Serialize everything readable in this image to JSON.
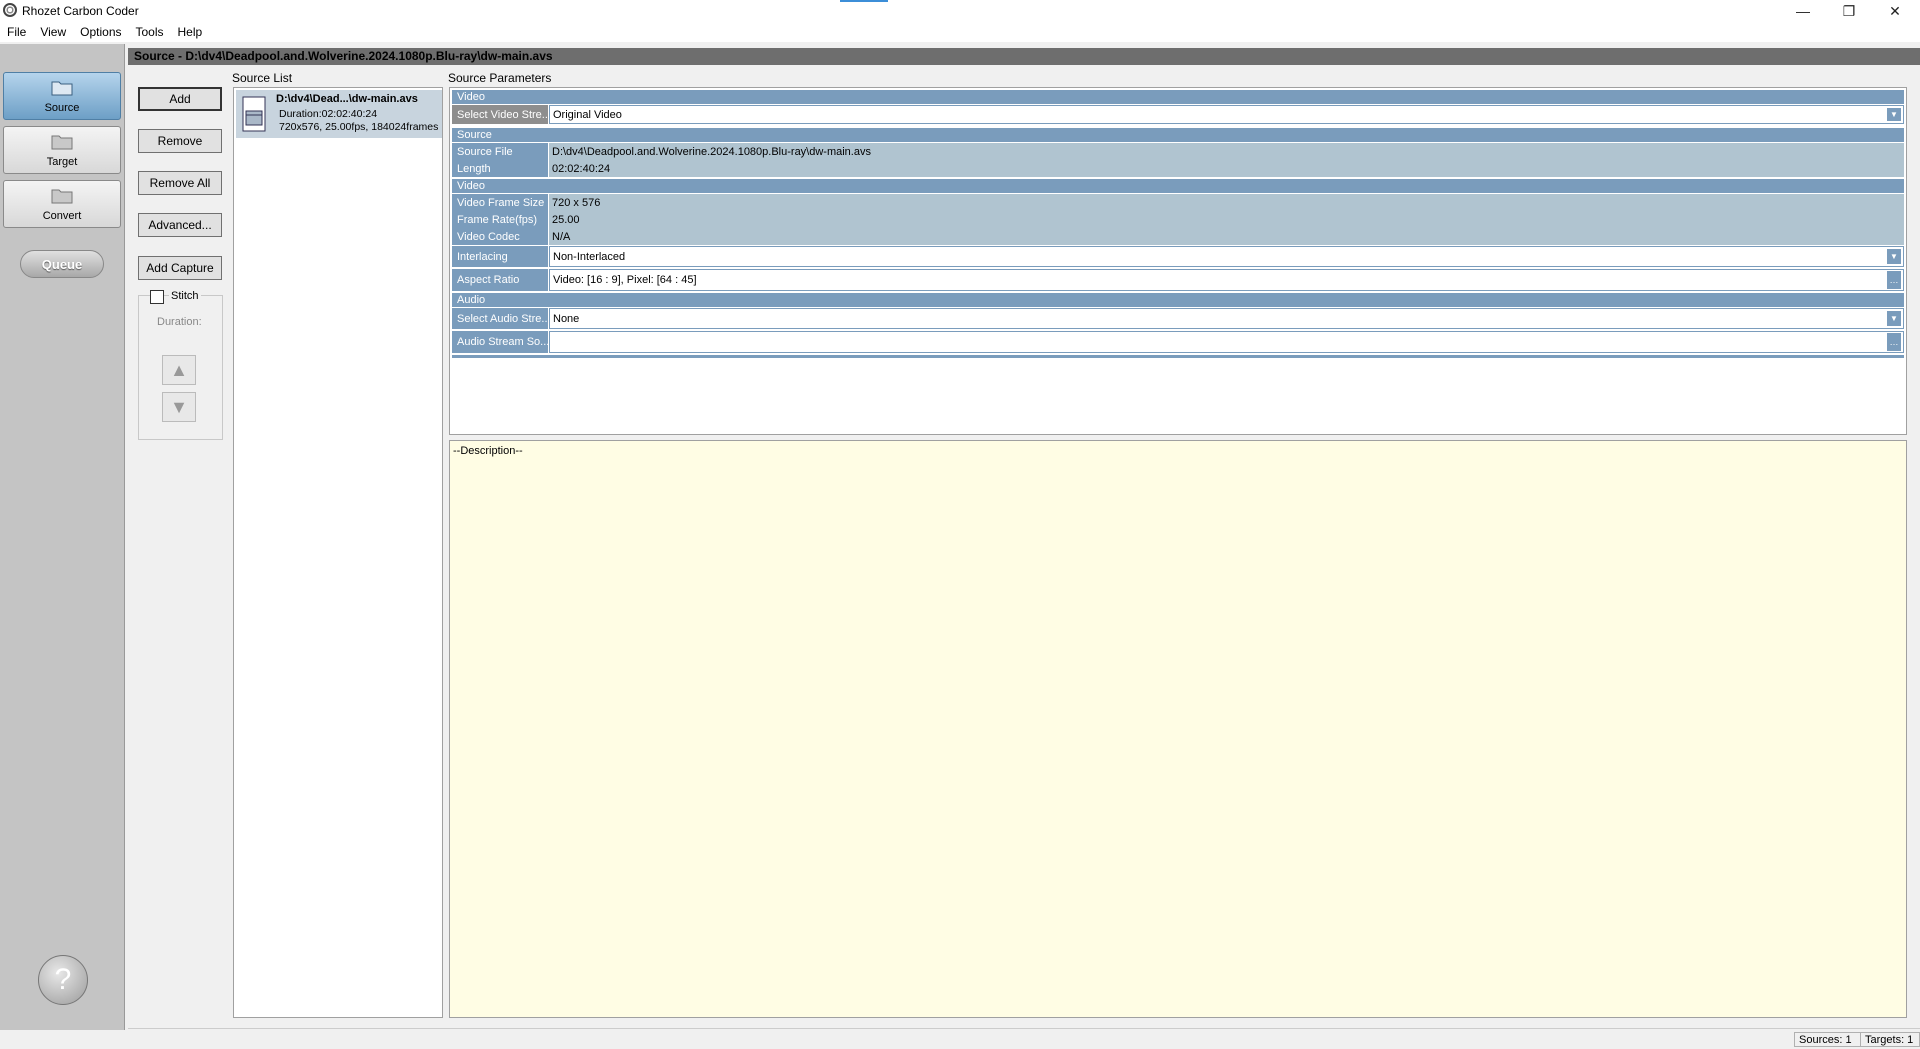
{
  "window": {
    "title": "Rhozet Carbon Coder",
    "controls": {
      "minimize": "—",
      "restore": "❐",
      "close": "✕"
    }
  },
  "menu": [
    "File",
    "View",
    "Options",
    "Tools",
    "Help"
  ],
  "nav": {
    "source": "Source",
    "target": "Target",
    "convert": "Convert",
    "queue": "Queue",
    "help": "?"
  },
  "header": {
    "title": "Source - D:\\dv4\\Deadpool.and.Wolverine.2024.1080p.Blu-ray\\dw-main.avs"
  },
  "actions": {
    "add": "Add",
    "remove": "Remove",
    "remove_all": "Remove All",
    "advanced": "Advanced...",
    "add_capture": "Add Capture",
    "stitch": "Stitch",
    "duration": "Duration:",
    "up": "▲",
    "down": "▼"
  },
  "source_list": {
    "label": "Source List",
    "item": {
      "name": "D:\\dv4\\Dead...\\dw-main.avs",
      "duration": "Duration:02:02:40:24",
      "details": "720x576, 25.00fps, 184024frames"
    }
  },
  "params": {
    "label": "Source Parameters",
    "video_section": "Video",
    "select_video_stream": {
      "label": "Select Video Stre...",
      "value": "Original Video"
    },
    "source_section": "Source",
    "source_file": {
      "label": "Source File",
      "value": "D:\\dv4\\Deadpool.and.Wolverine.2024.1080p.Blu-ray\\dw-main.avs"
    },
    "length": {
      "label": "Length",
      "value": "02:02:40:24"
    },
    "video_sub_section": "Video",
    "frame_size": {
      "label": "Video Frame Size",
      "value": "720 x 576"
    },
    "frame_rate": {
      "label": "Frame Rate(fps)",
      "value": "25.00"
    },
    "codec": {
      "label": "Video Codec",
      "value": "N/A"
    },
    "interlacing": {
      "label": "Interlacing",
      "value": "Non-Interlaced"
    },
    "aspect_ratio": {
      "label": "Aspect Ratio",
      "value": "Video: [16 : 9], Pixel: [64 : 45]"
    },
    "audio_section": "Audio",
    "select_audio_stream": {
      "label": "Select Audio Stre...",
      "value": "None"
    },
    "audio_stream_source": {
      "label": "Audio Stream So...",
      "value": ""
    }
  },
  "description": {
    "text": "--Description--"
  },
  "status": {
    "sources": "Sources: 1",
    "targets": "Targets: 1"
  }
}
